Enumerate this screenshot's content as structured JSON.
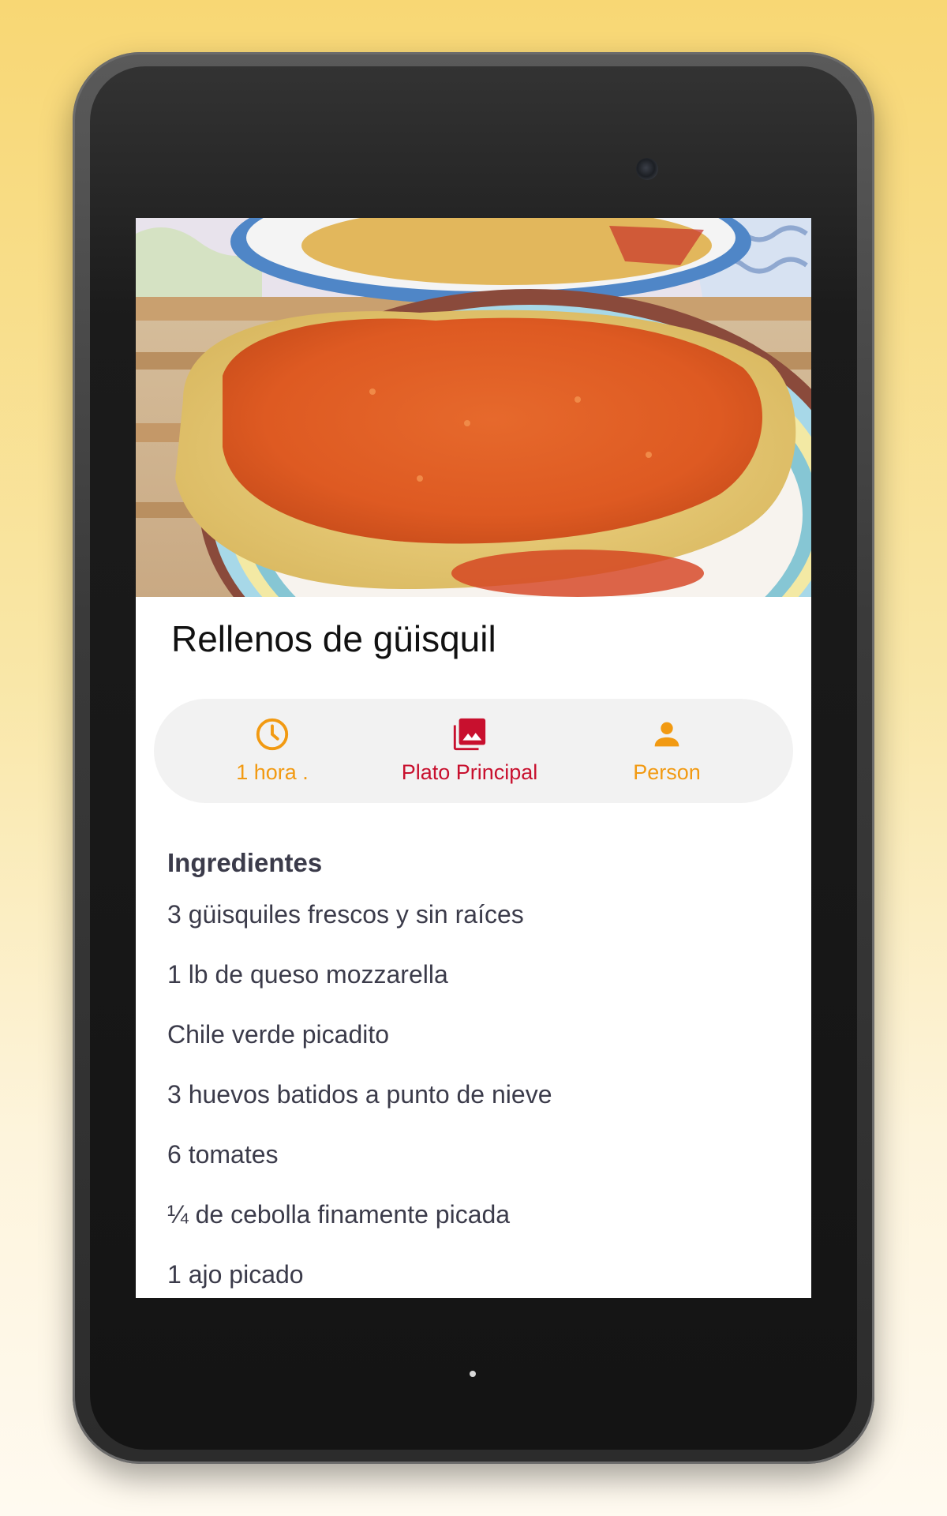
{
  "recipe": {
    "title": "Rellenos de güisquil",
    "time_label": "1 hora .",
    "category_label": "Plato  Principal",
    "servings_label": "Person",
    "time_icon": "clock-icon",
    "category_icon": "photo-library-icon",
    "servings_icon": "person-icon"
  },
  "ingredients": {
    "heading": "Ingredientes",
    "items": [
      "3 güisquiles frescos y sin raíces",
      "1 lb de queso mozzarella",
      "Chile verde picadito",
      "3 huevos batidos a punto de nieve",
      "6 tomates",
      "¼ de cebolla finamente picada",
      "1 ajo picado"
    ]
  },
  "colors": {
    "accent_orange": "#f29a12",
    "accent_red": "#c8102e",
    "text_dark": "#3b3b4a",
    "pill_bg": "#f2f2f2"
  }
}
